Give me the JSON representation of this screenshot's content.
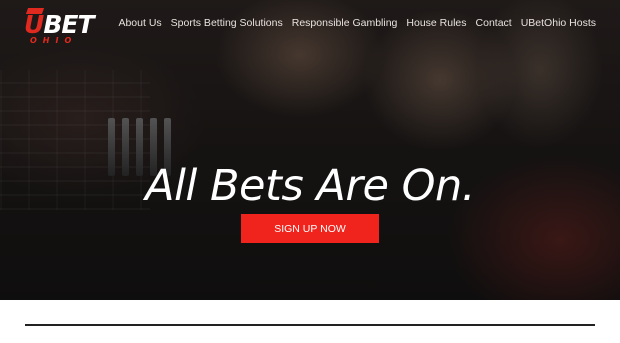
{
  "brand": {
    "logo_main": "BET",
    "logo_initial": "U",
    "logo_sub": "OHIO",
    "accent_color": "#f0241c"
  },
  "nav": {
    "items": [
      {
        "label": "About Us"
      },
      {
        "label": "Sports Betting Solutions"
      },
      {
        "label": "Responsible Gambling"
      },
      {
        "label": "House Rules"
      },
      {
        "label": "Contact"
      },
      {
        "label": "UBetOhio Hosts"
      }
    ]
  },
  "hero": {
    "headline": "All Bets Are On.",
    "cta_label": "SIGN UP NOW"
  }
}
